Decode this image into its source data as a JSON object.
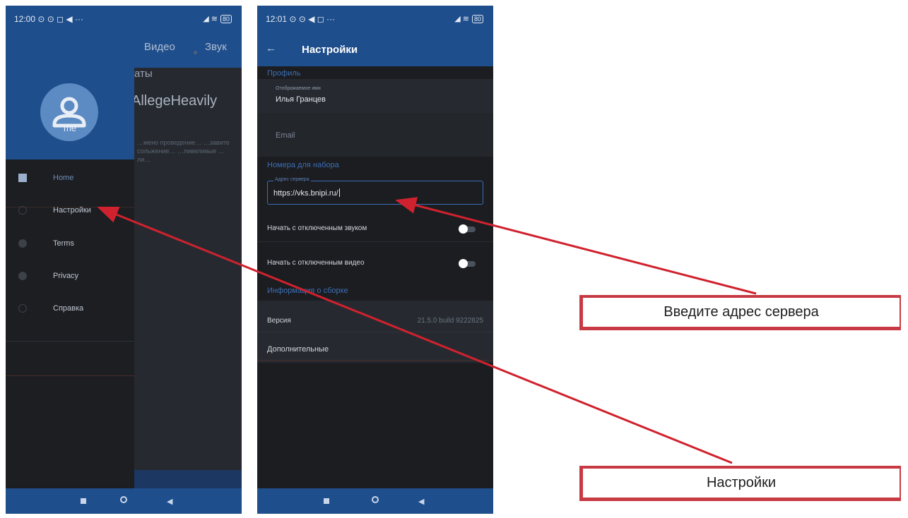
{
  "phone1": {
    "status_time": "12:00 ⊙ ⊙ ◻ ◀ ···",
    "status_right": "◢ ≋",
    "battery": "80",
    "bg_tabs": [
      "Видео",
      "Звук"
    ],
    "bg_heading": "аты",
    "bg_room": "AllegeHeavily",
    "bg_desc": "…мено проведение… …завите сольжение… …ливеливые …ли…",
    "drawer_name": "me",
    "menu": [
      {
        "label": "Home",
        "icon": "home-icon"
      },
      {
        "label": "Настройки",
        "icon": "gear-icon"
      },
      {
        "label": "Terms",
        "icon": "info-icon"
      },
      {
        "label": "Privacy",
        "icon": "info-icon"
      },
      {
        "label": "Справка",
        "icon": "help-icon"
      }
    ]
  },
  "phone2": {
    "status_time": "12:01 ⊙ ⊙ ◀ ◻ ···",
    "status_right": "◢ ≋",
    "battery": "80",
    "back_icon": "←",
    "title": "Настройки",
    "section_profile": "Профиль",
    "display_name_label": "Отображаемое имя",
    "display_name_value": "Илья Гранцев",
    "email_placeholder": "Email",
    "section_numbers": "Номера для набора",
    "server_label": "Адрес сервера",
    "server_value": "https://vks.bnipi.ru/",
    "mute_audio_label": "Начать с отключенным звуком",
    "mute_video_label": "Начать с отключенным видео",
    "section_build": "Информация о сборке",
    "version_label": "Версия",
    "version_value": "21.5.0 build 9222825",
    "advanced_label": "Дополнительные"
  },
  "callouts": {
    "server_hint": "Введите адрес сервера",
    "settings_hint": "Настройки"
  },
  "colors": {
    "accent_blue": "#1f4e8c",
    "arrow_red": "#d0222e",
    "callout_border": "#c83a43"
  }
}
